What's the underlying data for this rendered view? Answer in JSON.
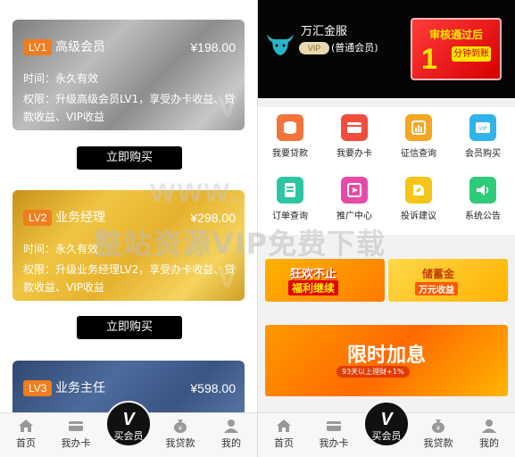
{
  "left": {
    "cards": [
      {
        "level": "LV1",
        "name": "高级会员",
        "price": "¥198.00",
        "duration": "时间：永久有效",
        "permission": "权限：升级高级会员LV1，享受办卡收益、贷款收益、VIP收益",
        "level_color": "#f07d1e"
      },
      {
        "level": "LV2",
        "name": "业务经理",
        "price": "¥298.00",
        "duration": "时间：永久有效",
        "permission": "权限：升级业务经理LV2，享受办卡收益、贷款收益、VIP收益",
        "level_color": "#f07d1e"
      },
      {
        "level": "LV3",
        "name": "业务主任",
        "price": "¥598.00",
        "duration": "",
        "permission": "",
        "level_color": "#f07d1e"
      }
    ],
    "buy_label": "立即购买"
  },
  "right": {
    "brand": "万汇金服",
    "vip_badge": "VIP",
    "user_type": "(普通会员)",
    "promo_title": "审核通过后",
    "promo_number": "1",
    "promo_unit": "分钟到账",
    "grid": [
      {
        "label": "我要贷款",
        "icon": "loan-icon",
        "color": "#f3743a"
      },
      {
        "label": "我要办卡",
        "icon": "card-icon",
        "color": "#f14d3d"
      },
      {
        "label": "征信查询",
        "icon": "credit-report-icon",
        "color": "#f5a623"
      },
      {
        "label": "会员购买",
        "icon": "vip-card-icon",
        "color": "#2fb3e8"
      },
      {
        "label": "订单查询",
        "icon": "order-icon",
        "color": "#2ec6a2"
      },
      {
        "label": "推广中心",
        "icon": "share-icon",
        "color": "#e84aa8"
      },
      {
        "label": "投诉建议",
        "icon": "feedback-icon",
        "color": "#f5c518"
      },
      {
        "label": "系统公告",
        "icon": "announcement-icon",
        "color": "#2ecb7a"
      }
    ],
    "banner1_title": "狂欢不止",
    "banner1_sub": "福利继续",
    "banner2_title": "储蓄金",
    "banner2_sub": "万元收益",
    "banner3_title": "限时加息",
    "banner3_sub": "93天以上理财+1%"
  },
  "tabbar": {
    "home": "首页",
    "card": "我办卡",
    "buy_vip": "买会员",
    "loan": "我贷款",
    "mine": "我的",
    "center_mark": "V"
  },
  "watermark": {
    "top": "WWW.",
    "main": "整站资源VIP免费下载"
  }
}
